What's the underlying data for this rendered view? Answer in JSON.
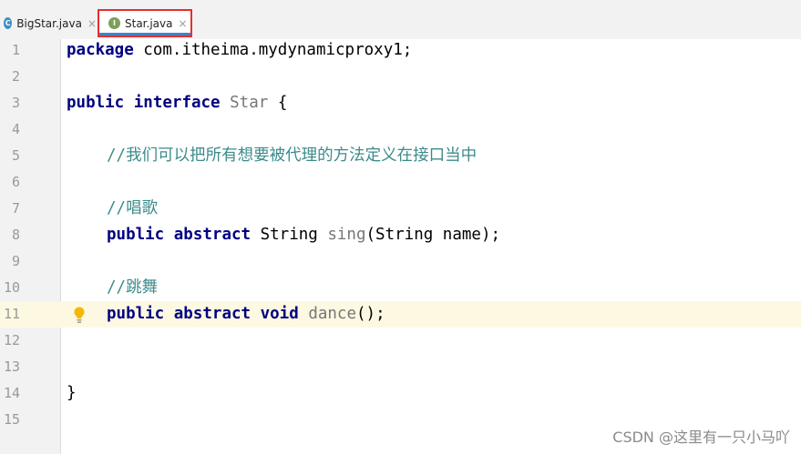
{
  "tabs": [
    {
      "label": "BigStar.java",
      "icon": "class-icon",
      "icon_letter": "C",
      "close": "×",
      "active": false
    },
    {
      "label": "Star.java",
      "icon": "interface-icon",
      "icon_letter": "I",
      "close": "×",
      "active": true
    }
  ],
  "editor": {
    "current_line": 11,
    "lines": [
      {
        "n": "1"
      },
      {
        "n": "2"
      },
      {
        "n": "3"
      },
      {
        "n": "4"
      },
      {
        "n": "5"
      },
      {
        "n": "6"
      },
      {
        "n": "7"
      },
      {
        "n": "8"
      },
      {
        "n": "9"
      },
      {
        "n": "10"
      },
      {
        "n": "11"
      },
      {
        "n": "12"
      },
      {
        "n": "13"
      },
      {
        "n": "14"
      },
      {
        "n": "15"
      }
    ],
    "code": {
      "l1_kw": "package",
      "l1_rest": " com.itheima.mydynamicproxy1;",
      "l3_kw1": "public",
      "l3_kw2": "interface",
      "l3_name": "Star",
      "l3_brace": " {",
      "l5_comment": "//我们可以把所有想要被代理的方法定义在接口当中",
      "l7_comment": "//唱歌",
      "l8_kw1": "public",
      "l8_kw2": "abstract",
      "l8_type": " String ",
      "l8_method": "sing",
      "l8_params": "(String name);",
      "l10_comment": "//跳舞",
      "l11_kw1": "public",
      "l11_kw2": "abstract",
      "l11_kw3": "void",
      "l11_method": "dance",
      "l11_params": "();",
      "l14_brace": "}"
    }
  },
  "intention_icon": "lightbulb-icon",
  "watermark": "CSDN @这里有一只小马吖",
  "colors": {
    "keyword": "#000080",
    "comment": "#3d8b8b",
    "current_line": "#fdf8e1",
    "tab_highlight": "#e3302f"
  }
}
